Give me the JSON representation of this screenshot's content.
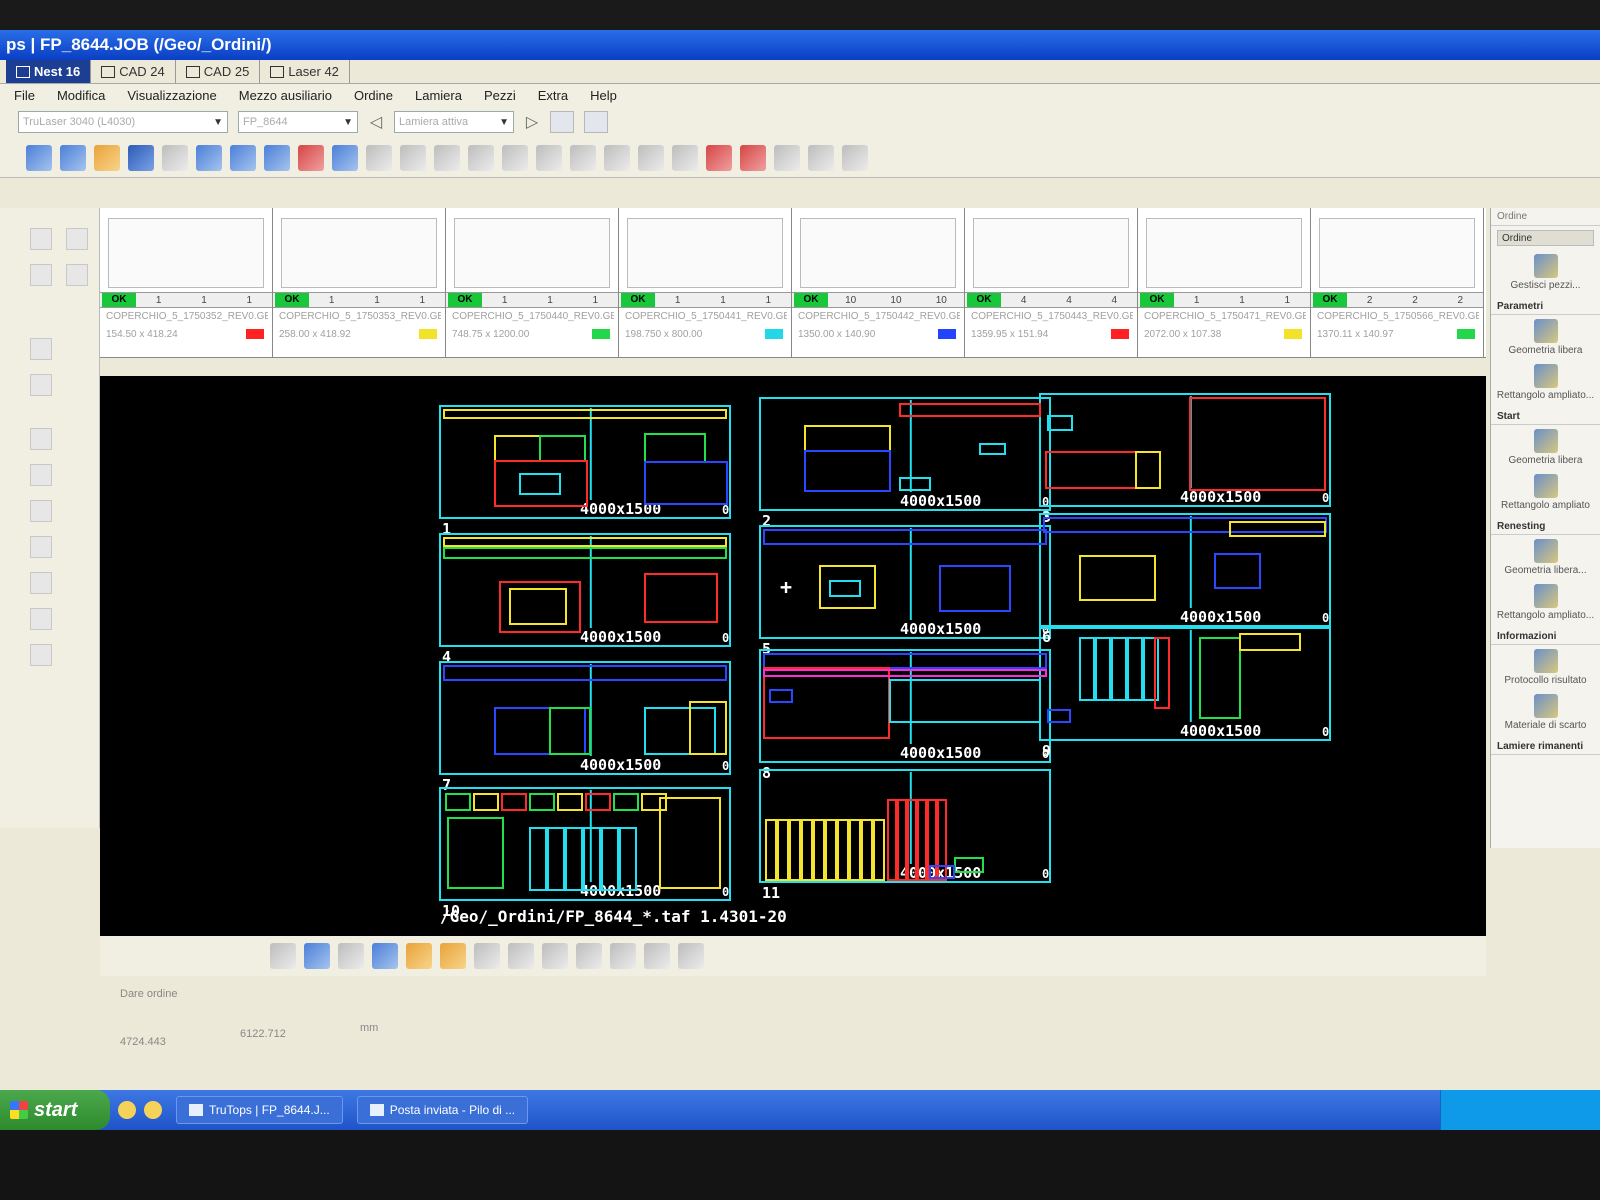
{
  "window": {
    "title": "ps | FP_8644.JOB (/Geo/_Ordini/)"
  },
  "tabs": [
    {
      "label": "Nest 16",
      "active": true
    },
    {
      "label": "CAD 24",
      "active": false
    },
    {
      "label": "CAD 25",
      "active": false
    },
    {
      "label": "Laser 42",
      "active": false
    }
  ],
  "menu": [
    "File",
    "Modifica",
    "Visualizzazione",
    "Mezzo ausiliario",
    "Ordine",
    "Lamiera",
    "Pezzi",
    "Extra",
    "Help"
  ],
  "combos": {
    "machine": "TruLaser 3040 (L4030)",
    "job": "FP_8644",
    "sheet": "Lamiera attiva"
  },
  "sheets": [
    {
      "ok": "OK",
      "counts": [
        "1",
        "1",
        "1"
      ],
      "name": "COPERCHIO_5_1750352_REV0.GEO",
      "dims": "154.50 x 418.24",
      "color": "#ff2222"
    },
    {
      "ok": "OK",
      "counts": [
        "1",
        "1",
        "1"
      ],
      "name": "COPERCHIO_5_1750353_REV0.GEO",
      "dims": "258.00 x 418.92",
      "color": "#f2e22a"
    },
    {
      "ok": "OK",
      "counts": [
        "1",
        "1",
        "1"
      ],
      "name": "COPERCHIO_5_1750440_REV0.GEO",
      "dims": "748.75 x 1200.00",
      "color": "#22d84a"
    },
    {
      "ok": "OK",
      "counts": [
        "1",
        "1",
        "1"
      ],
      "name": "COPERCHIO_5_1750441_REV0.GEO",
      "dims": "198.750 x 800.00",
      "color": "#22d8e8"
    },
    {
      "ok": "OK",
      "counts": [
        "10",
        "10",
        "10"
      ],
      "name": "COPERCHIO_5_1750442_REV0.GEO",
      "dims": "1350.00 x 140.90",
      "color": "#2244ff"
    },
    {
      "ok": "OK",
      "counts": [
        "4",
        "4",
        "4"
      ],
      "name": "COPERCHIO_5_1750443_REV0.GEO",
      "dims": "1359.95 x 151.94",
      "color": "#ff2222"
    },
    {
      "ok": "OK",
      "counts": [
        "1",
        "1",
        "1"
      ],
      "name": "COPERCHIO_5_1750471_REV0.GEO",
      "dims": "2072.00 x 107.38",
      "color": "#f2e22a"
    },
    {
      "ok": "OK",
      "counts": [
        "2",
        "2",
        "2"
      ],
      "name": "COPERCHIO_5_1750566_REV0.GEO",
      "dims": "1370.11 x 140.97",
      "color": "#22d84a"
    }
  ],
  "canvas": {
    "plates": [
      {
        "num": "1",
        "size": "4000x1500",
        "zero": "0"
      },
      {
        "num": "2",
        "size": "4000x1500",
        "zero": "0"
      },
      {
        "num": "3",
        "size": "4000x1500",
        "zero": "0"
      },
      {
        "num": "4",
        "size": "4000x1500",
        "zero": "0"
      },
      {
        "num": "5",
        "size": "4000x1500",
        "zero": "0"
      },
      {
        "num": "6",
        "size": "4000x1500",
        "zero": "0"
      },
      {
        "num": "7",
        "size": "4000x1500",
        "zero": "0"
      },
      {
        "num": "8",
        "size": "4000x1500",
        "zero": "0"
      },
      {
        "num": "9",
        "size": "4000x1500",
        "zero": "0"
      },
      {
        "num": "10",
        "size": "4000x1500",
        "zero": "0"
      },
      {
        "num": "11",
        "size": "4000x1500",
        "zero": "0"
      }
    ],
    "footer": "/Geo/_Ordini/FP_8644_*.taf  1.4301-20"
  },
  "right_panel": {
    "title": "Ordine",
    "tab": "Ordine",
    "top_item": "Gestisci pezzi...",
    "sections": [
      {
        "title": "Parametri",
        "items": [
          "Geometria libera",
          "Rettangolo ampliato..."
        ]
      },
      {
        "title": "Start",
        "items": [
          "Geometria libera",
          "Rettangolo ampliato"
        ]
      },
      {
        "title": "Renesting",
        "items": [
          "Geometria libera...",
          "Rettangolo ampliato..."
        ]
      },
      {
        "title": "Informazioni",
        "items": [
          "Protocollo risultato",
          "Materiale di scarto"
        ]
      },
      {
        "title": "Lamiere rimanenti",
        "items": []
      }
    ]
  },
  "status": {
    "label": "Dare ordine",
    "x": "4724.443",
    "y": "6122.712",
    "unit": "mm"
  },
  "taskbar": {
    "start": "start",
    "items": [
      "TruTops | FP_8644.J...",
      "Posta inviata - Pilo di ..."
    ]
  },
  "colors": {
    "cyan": "#22e0f0",
    "blue": "#2a48ff",
    "red": "#ff2a2a",
    "yellow": "#f5e52a",
    "green": "#22e04a",
    "magenta": "#ff2ad8",
    "white": "#ffffff"
  }
}
